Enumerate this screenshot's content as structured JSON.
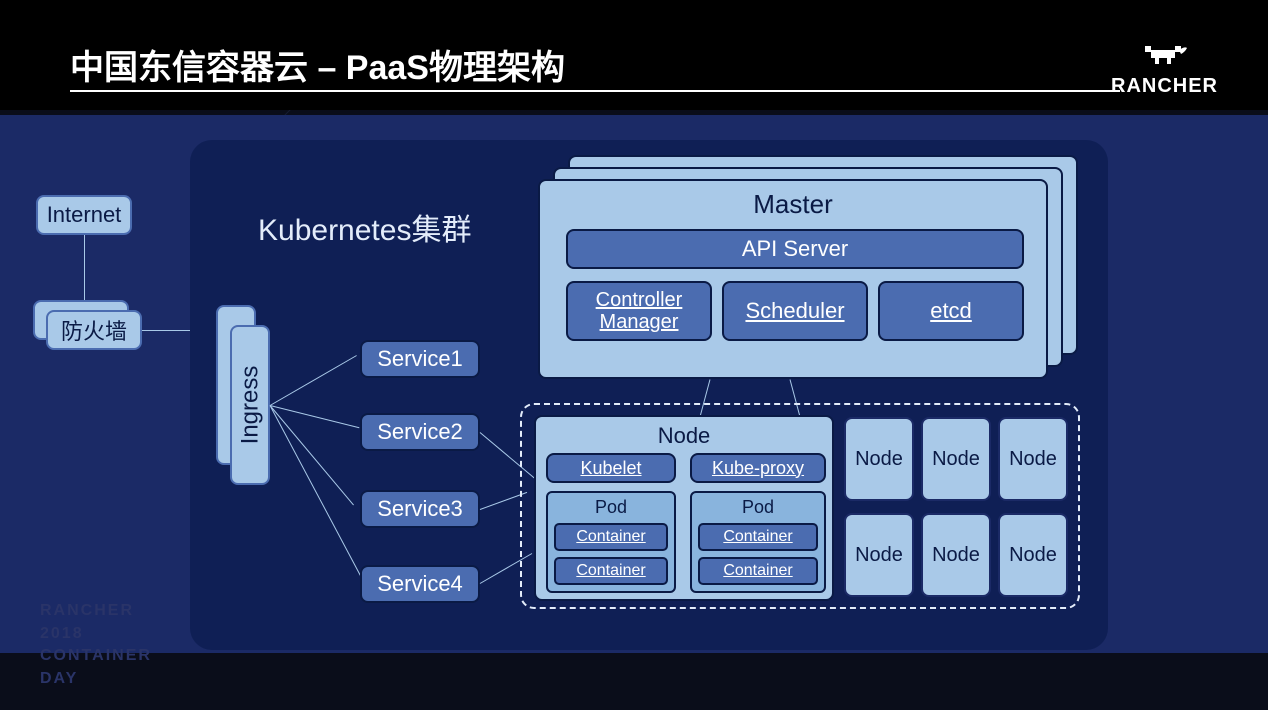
{
  "header": {
    "title": "中国东信容器云 – PaaS物理架构",
    "brand": "RANCHER"
  },
  "left": {
    "internet": "Internet",
    "firewall": "防火墙"
  },
  "cluster": {
    "label": "Kubernetes集群",
    "ingress": "Ingress",
    "services": [
      "Service1",
      "Service2",
      "Service3",
      "Service4"
    ]
  },
  "master": {
    "title": "Master",
    "api_server": "API Server",
    "controller_manager": "Controller Manager",
    "scheduler": "Scheduler",
    "etcd": "etcd"
  },
  "node": {
    "title": "Node",
    "kubelet": "Kubelet",
    "kube_proxy": "Kube-proxy",
    "pod_label": "Pod",
    "container_label": "Container",
    "small_nodes": [
      "Node",
      "Node",
      "Node",
      "Node",
      "Node",
      "Node"
    ]
  },
  "watermark": {
    "l1": "RANCHER",
    "l2": "2018",
    "l3": "CONTAINER",
    "l4": "DAY"
  }
}
